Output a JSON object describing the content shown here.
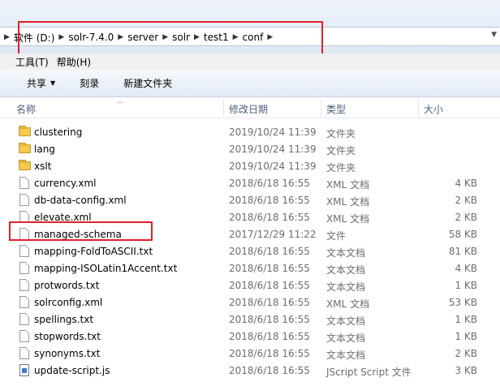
{
  "address": {
    "crumbs": [
      "软件 (D:)",
      "solr-7.4.0",
      "server",
      "solr",
      "test1",
      "conf"
    ]
  },
  "menu": {
    "items": [
      "工具(T)",
      "帮助(H)"
    ]
  },
  "toolbar": {
    "share_label": "共享",
    "burn_label": "刻录",
    "new_folder_label": "新建文件夹"
  },
  "columns": {
    "name": "名称",
    "date": "修改日期",
    "type": "类型",
    "size": "大小"
  },
  "files": [
    {
      "name": "clustering",
      "date": "2019/10/24 11:39",
      "type": "文件夹",
      "size": "",
      "kind": "folder"
    },
    {
      "name": "lang",
      "date": "2019/10/24 11:39",
      "type": "文件夹",
      "size": "",
      "kind": "folder"
    },
    {
      "name": "xslt",
      "date": "2019/10/24 11:39",
      "type": "文件夹",
      "size": "",
      "kind": "folder"
    },
    {
      "name": "currency.xml",
      "date": "2018/6/18 16:55",
      "type": "XML 文档",
      "size": "4 KB",
      "kind": "file"
    },
    {
      "name": "db-data-config.xml",
      "date": "2018/6/18 16:55",
      "type": "XML 文档",
      "size": "2 KB",
      "kind": "file"
    },
    {
      "name": "elevate.xml",
      "date": "2018/6/18 16:55",
      "type": "XML 文档",
      "size": "2 KB",
      "kind": "file"
    },
    {
      "name": "managed-schema",
      "date": "2017/12/29 11:22",
      "type": "文件",
      "size": "58 KB",
      "kind": "file"
    },
    {
      "name": "mapping-FoldToASCII.txt",
      "date": "2018/6/18 16:55",
      "type": "文本文档",
      "size": "81 KB",
      "kind": "file"
    },
    {
      "name": "mapping-ISOLatin1Accent.txt",
      "date": "2018/6/18 16:55",
      "type": "文本文档",
      "size": "4 KB",
      "kind": "file"
    },
    {
      "name": "protwords.txt",
      "date": "2018/6/18 16:55",
      "type": "文本文档",
      "size": "1 KB",
      "kind": "file"
    },
    {
      "name": "solrconfig.xml",
      "date": "2018/6/18 16:55",
      "type": "XML 文档",
      "size": "53 KB",
      "kind": "file"
    },
    {
      "name": "spellings.txt",
      "date": "2018/6/18 16:55",
      "type": "文本文档",
      "size": "1 KB",
      "kind": "file"
    },
    {
      "name": "stopwords.txt",
      "date": "2018/6/18 16:55",
      "type": "文本文档",
      "size": "1 KB",
      "kind": "file"
    },
    {
      "name": "synonyms.txt",
      "date": "2018/6/18 16:55",
      "type": "文本文档",
      "size": "2 KB",
      "kind": "file"
    },
    {
      "name": "update-script.js",
      "date": "2018/6/18 16:55",
      "type": "JScript Script 文件",
      "size": "3 KB",
      "kind": "script"
    }
  ],
  "highlight_color": "#e0202a"
}
